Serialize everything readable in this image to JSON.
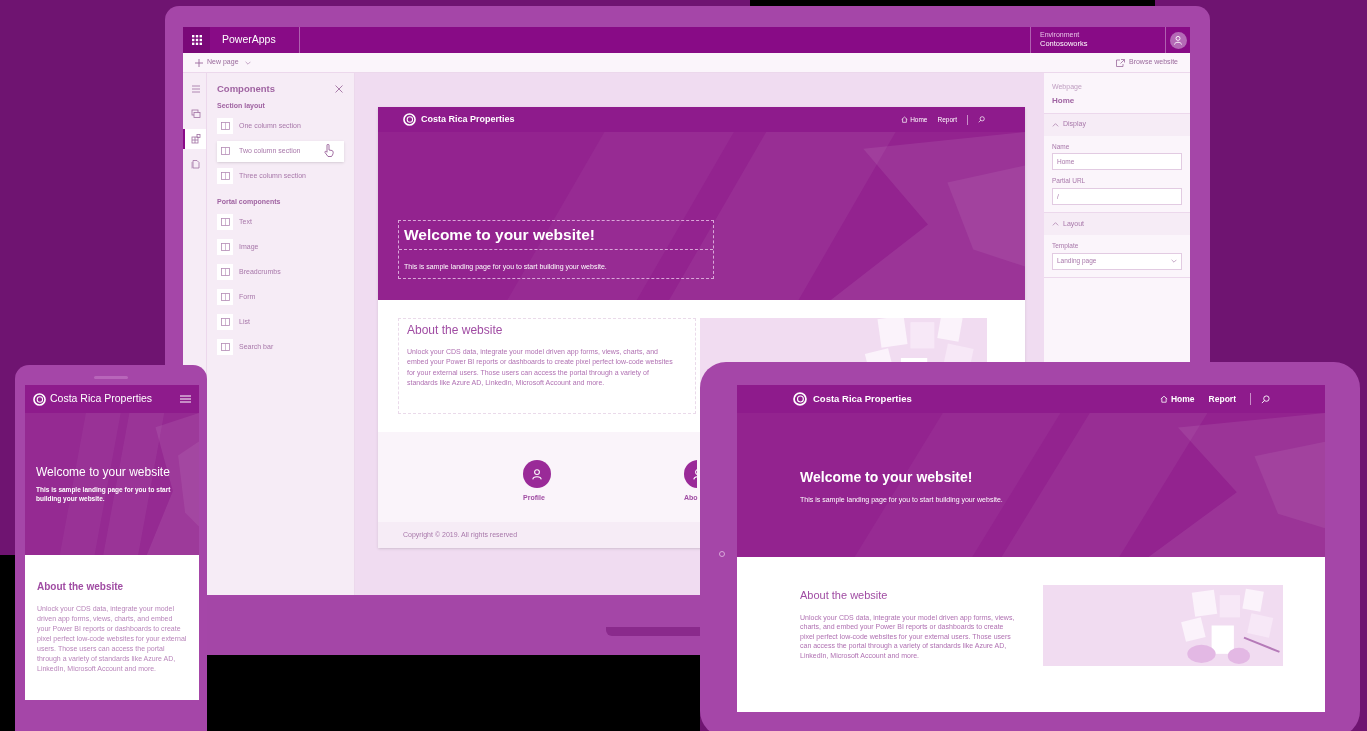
{
  "laptop": {
    "app_bar": {
      "app_name": "PowerApps",
      "environment_label": "Environment",
      "environment": "Contosoworks"
    },
    "command_bar": {
      "new_page": "New page",
      "browse": "Browse website"
    },
    "rail": [
      {
        "selected": false
      },
      {
        "selected": false
      },
      {
        "selected": true
      },
      {
        "selected": false
      }
    ],
    "components_panel": {
      "title": "Components",
      "sections": [
        {
          "heading": "Section layout",
          "items": [
            {
              "label": "One column section",
              "selected": false
            },
            {
              "label": "Two column section",
              "selected": true
            },
            {
              "label": "Three column section",
              "selected": false
            }
          ]
        },
        {
          "heading": "Portal components",
          "items": [
            {
              "label": "Text",
              "selected": false
            },
            {
              "label": "Image",
              "selected": false
            },
            {
              "label": "Breadcrumbs",
              "selected": false
            },
            {
              "label": "Form",
              "selected": false
            },
            {
              "label": "List",
              "selected": false
            },
            {
              "label": "Search bar",
              "selected": false
            }
          ]
        }
      ]
    },
    "preview": {
      "brand": "Costa Rica Properties",
      "nav": [
        "Home",
        "Report"
      ],
      "hero_title": "Welcome to your website!",
      "hero_subtitle": "This is sample landing page for you to start building your website.",
      "about_title": "About the website",
      "about_text": "Unlock your CDS data, integrate your model driven app forms, views, charts, and embed your Power BI reports or dashboards to create pixel perfect low-code websites for your external users.  Those users can access the portal through a variety of standards like Azure AD, LinkedIn, Microsoft Account and more.",
      "profiles": [
        "Profile",
        "Abo"
      ],
      "footer": "Copyright © 2019. All rights reserved"
    },
    "properties": {
      "caption": "Webpage",
      "page": "Home",
      "groups": [
        {
          "title": "Display",
          "expanded": true,
          "fields": [
            {
              "kind": "text",
              "label": "Name",
              "value": "Home"
            },
            {
              "kind": "text",
              "label": "Partial URL",
              "value": "/"
            }
          ]
        },
        {
          "title": "Layout",
          "expanded": true,
          "fields": [
            {
              "kind": "select",
              "label": "Template",
              "value": "Landing page"
            }
          ]
        }
      ]
    }
  },
  "phone": {
    "brand": "Costa Rica Properties",
    "hero_title": "Welcome to your website",
    "hero_subtitle": "This is sample landing page for you to start building your website.",
    "about_title": "About the website",
    "about_text": "Unlock your CDS data, integrate your model driven app forms, views, charts, and embed your Power BI reports or dashboards to create pixel perfect low-code websites for your external users. Those users can access the portal through a variety of standards like Azure AD, LinkedIn, Microsoft Account and more."
  },
  "tablet": {
    "brand": "Costa Rica Properties",
    "nav": [
      "Home",
      "Report"
    ],
    "hero_title": "Welcome to your website!",
    "hero_subtitle": "This is sample landing page for you to start building your website.",
    "about_title": "About the website",
    "about_text": "Unlock your CDS data, integrate your model driven app forms, views, charts, and embed your Power BI reports or dashboards to create pixel perfect low-code websites for your external users. Those users can access the portal through a variety of standards like Azure AD, LinkedIn, Microsoft Account and more."
  }
}
